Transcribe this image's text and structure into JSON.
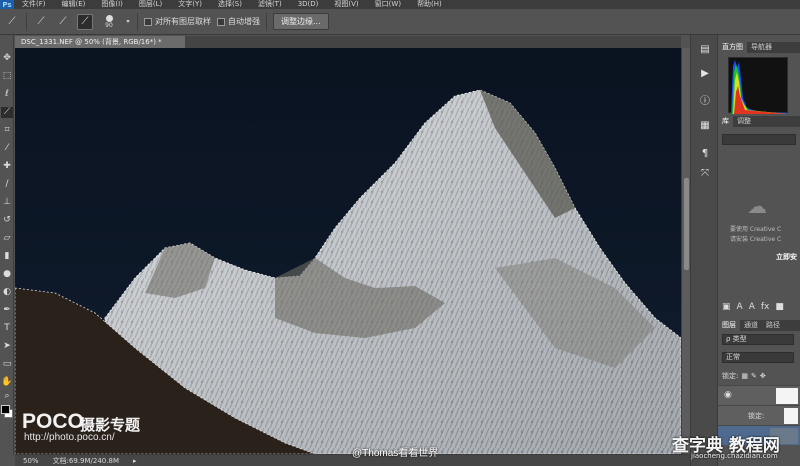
{
  "menubar": {
    "items": [
      "文件(F)",
      "编辑(E)",
      "图像(I)",
      "图层(L)",
      "文字(Y)",
      "选择(S)",
      "滤镜(T)",
      "3D(D)",
      "视图(V)",
      "窗口(W)",
      "帮助(H)"
    ]
  },
  "options": {
    "brush_size": "90",
    "sample_all_layers": "对所有图层取样",
    "auto_enhance": "自动增强",
    "refine_edge": "调整边缘..."
  },
  "document": {
    "tab_title": "DSC_1331.NEF @ 50% (背景, RGB/16*) *"
  },
  "status": {
    "zoom": "50%",
    "doc_size": "文档:69.9M/240.8M"
  },
  "panels": {
    "top_tabs": [
      "直方图",
      "导航器"
    ],
    "mid_tabs": [
      "库",
      "调整"
    ],
    "cc_message_1": "要使用 Creative C",
    "cc_message_2": "请安装 Creative C",
    "cc_button": "立即安",
    "layers_tabs": [
      "图层",
      "通道",
      "路径"
    ],
    "filter_kind": "ρ 类型",
    "blend_mode": "正常",
    "lock_label": "锁定:"
  },
  "watermarks": {
    "poco": "POCO",
    "poco_cn": "摄影专题",
    "poco_url": "http://photo.poco.cn/",
    "author": "@Thomas看看世界",
    "site": "查字典 教程网",
    "site_url": "jiaocheng.chazidian.com"
  },
  "colors": {
    "sky": "#0b1422",
    "ui_dark": "#535353",
    "ps_blue": "#1d5ea8"
  }
}
